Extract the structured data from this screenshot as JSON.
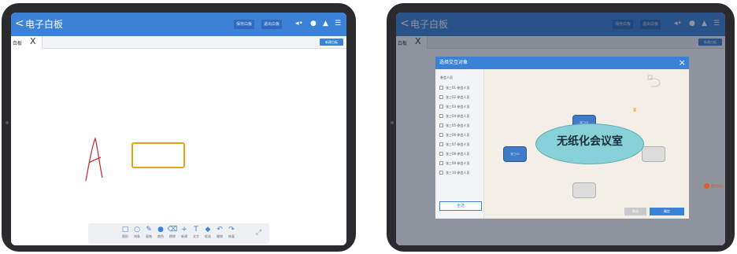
{
  "left_tablet": {
    "topbar": {
      "back_glyph": "<",
      "title": "电子白板",
      "btn_1": "保存白板",
      "btn_2": "退出白板"
    },
    "tab": {
      "label": "白板",
      "close_glyph": "X",
      "action_label": "新建白板"
    },
    "canvas": {
      "handwritten_letter": "A",
      "rect_color": "#e8a21a",
      "stroke_color": "#c8303a"
    },
    "toolbar": {
      "tools": [
        {
          "glyph": "□",
          "label": "图形"
        },
        {
          "glyph": "○",
          "label": "线条"
        },
        {
          "glyph": "✎",
          "label": "画笔"
        },
        {
          "glyph": "●",
          "label": "颜色"
        },
        {
          "glyph": "⌫",
          "label": "擦除"
        },
        {
          "glyph": "+",
          "label": "新建"
        },
        {
          "glyph": "T",
          "label": "文字"
        },
        {
          "glyph": "◆",
          "label": "框选"
        },
        {
          "glyph": "↶",
          "label": "撤销"
        },
        {
          "glyph": "↷",
          "label": "恢复"
        }
      ],
      "expand_glyph": "⤢"
    }
  },
  "right_tablet": {
    "topbar": {
      "back_glyph": "<",
      "title": "电子白板",
      "btn_1": "保存白板",
      "btn_2": "退出白板"
    },
    "tab": {
      "label": "白板",
      "close_glyph": "X",
      "action_label": "新建白板"
    },
    "dialog": {
      "title": "选择交互对象",
      "close_glyph": "×",
      "side_heading": "参会人员",
      "attendees": [
        "张三01·参会人员",
        "张三02·参会人员",
        "张三03·参会人员",
        "张三04·参会人员",
        "张三05·参会人员",
        "张三06·参会人员",
        "张三07·参会人员",
        "张三08·参会人员",
        "张三09·参会人员",
        "张三10·参会人员"
      ],
      "select_all": "全选",
      "cancel": "取消",
      "confirm": "确定",
      "room_label": "无纸化会议室",
      "seat_top": "张三01",
      "seat_left": "张三02"
    },
    "side_watermark": "数字科技"
  },
  "colors": {
    "accent": "#3b82d6",
    "table": "#86d2d8",
    "tablet_frame": "#2b2b2f"
  }
}
